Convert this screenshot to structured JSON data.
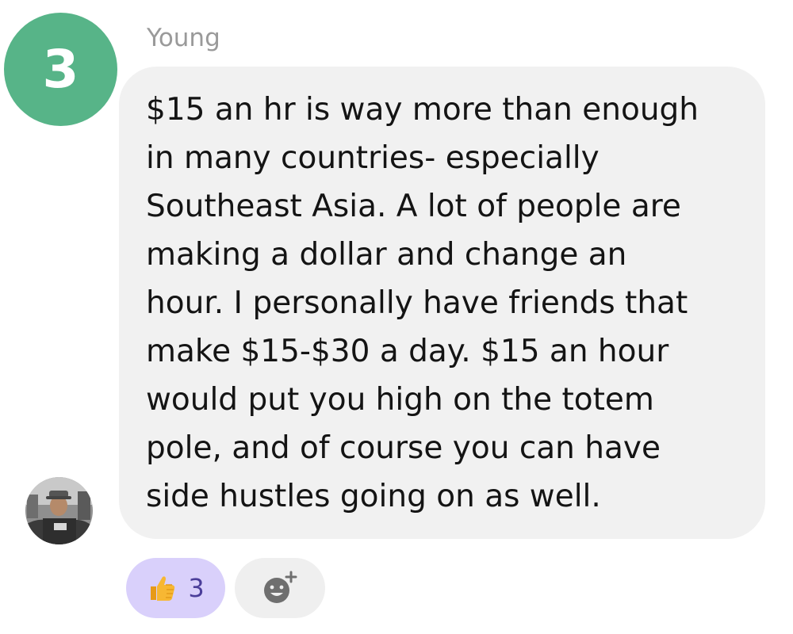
{
  "badge": {
    "number": "3"
  },
  "message": {
    "sender": "Young",
    "lines": [
      "$15 an hr is way more than enough",
      "in many countries- especially",
      "Southeast Asia. A lot of people are",
      "making a dollar and change an",
      "hour. I personally have friends that",
      "make $15-$30 a day. $15 an hour",
      "would put you high on the totem",
      "pole, and of course you can have",
      "side hustles going on as well."
    ]
  },
  "reactions": {
    "thumbs_up": {
      "icon": "thumbs-up-icon",
      "count": "3"
    },
    "add_reaction": {
      "icon": "add-emoji-icon"
    }
  },
  "colors": {
    "badge": "#57b488",
    "bubble": "#f1f1f1",
    "reaction_active": "#d9d0fb",
    "reaction_inactive": "#efefef"
  }
}
